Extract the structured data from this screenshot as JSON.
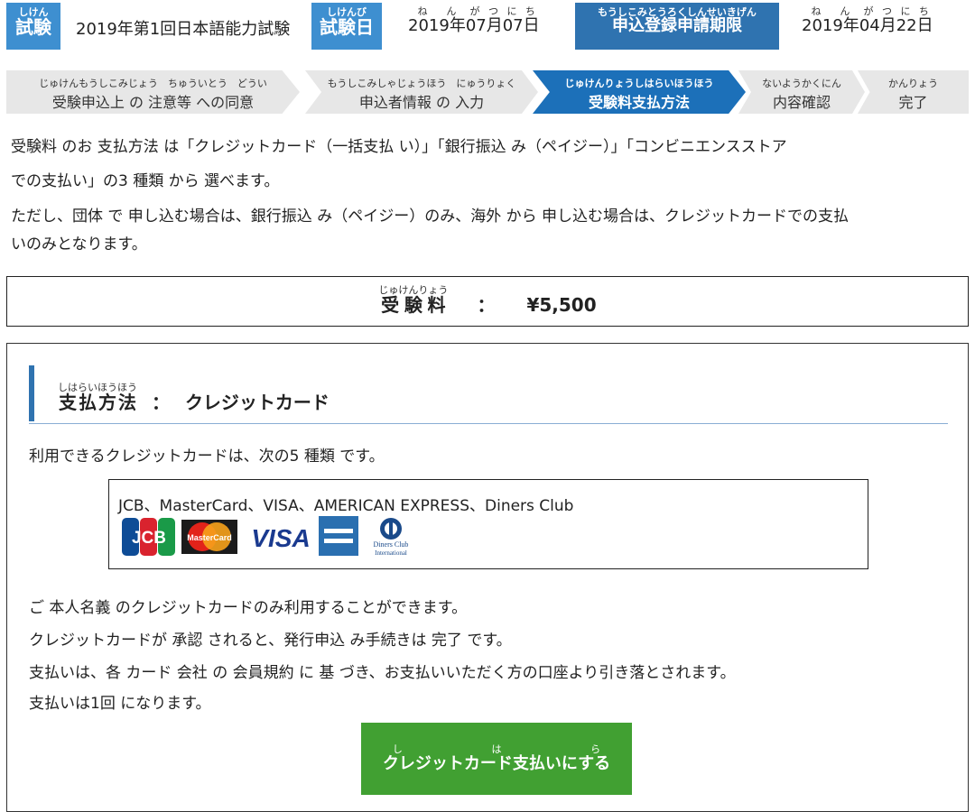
{
  "header": {
    "exam_tag": "試験",
    "exam_tag_ruby": "しけん",
    "exam_name": "2019年第1回日本語能力試験",
    "date_tag": "試験日",
    "date_tag_ruby": "しけんび",
    "exam_date": {
      "year": "2019",
      "month": "07",
      "day": "07",
      "ruby_year": "ねん",
      "ruby_month": "がつ",
      "ruby_day": "にち",
      "k_year": "年",
      "k_month": "月",
      "k_day": "日"
    },
    "deadline_tag": "申込登録申請期限",
    "deadline_tag_ruby": "もうしこみとうろくしんせいきげん",
    "deadline_date": {
      "year": "2019",
      "month": "04",
      "day": "22"
    }
  },
  "steps": [
    {
      "ruby": "じゅけんもうしこみじょう　ちゅういとう　どうい",
      "label": "受験申込上 の 注意等 への同意"
    },
    {
      "ruby": "もうしこみしゃじょうほう　にゅうりょく",
      "label": "申込者情報 の 入力"
    },
    {
      "ruby": "じゅけんりょうしはらいほうほう",
      "label": "受験料支払方法"
    },
    {
      "ruby": "ないようかくにん",
      "label": "内容確認"
    },
    {
      "ruby": "かんりょう",
      "label": "完了"
    }
  ],
  "intro": {
    "line1": "受験料 のお 支払方法 は「クレジットカード（一括支払 い）」「銀行振込 み（ペイジー）」「コンビニエンスストア",
    "line2": "での支払い」の3 種類 から 選べます。",
    "line3": "ただし、団体 で 申し込む場合は、銀行振込 み（ペイジー）のみ、海外 から 申し込む場合は、クレジットカードでの支払",
    "line4": "いのみとなります。"
  },
  "fee": {
    "label": "受験料",
    "label_ruby": "じゅけんりょう",
    "sep": "：",
    "amount": "¥5,500"
  },
  "payment": {
    "title_ruby": "しはらいほうほう",
    "title": "支払方法",
    "title_sep": "：",
    "title_method": "クレジットカード",
    "available": "利用できるクレジットカードは、次の5 種類 です。",
    "cards_text": "JCB、MasterCard、VISA、AMERICAN EXPRESS、Diners Club",
    "logos": {
      "jcb": "JCB",
      "mastercard": "MasterCard",
      "visa": "VISA",
      "diners_line1": "Diners Club",
      "diners_line2": "International"
    },
    "note1": "ご 本人名義 のクレジットカードのみ利用することができます。",
    "note2": "クレジットカードが 承認 されると、発行申込 み手続きは 完了 です。",
    "note3": "支払いは、各 カード 会社 の 会員規約 に 基 づき、お支払いいただく方の口座より引き落とされます。",
    "note4": "支払いは1回 になります。",
    "button_label": "クレジットカード支払いにする",
    "button_ruby": "しはら"
  },
  "colors": {
    "tag_blue": "#3e8fd0",
    "active_step": "#1c70b9",
    "button_green": "#41a032"
  }
}
